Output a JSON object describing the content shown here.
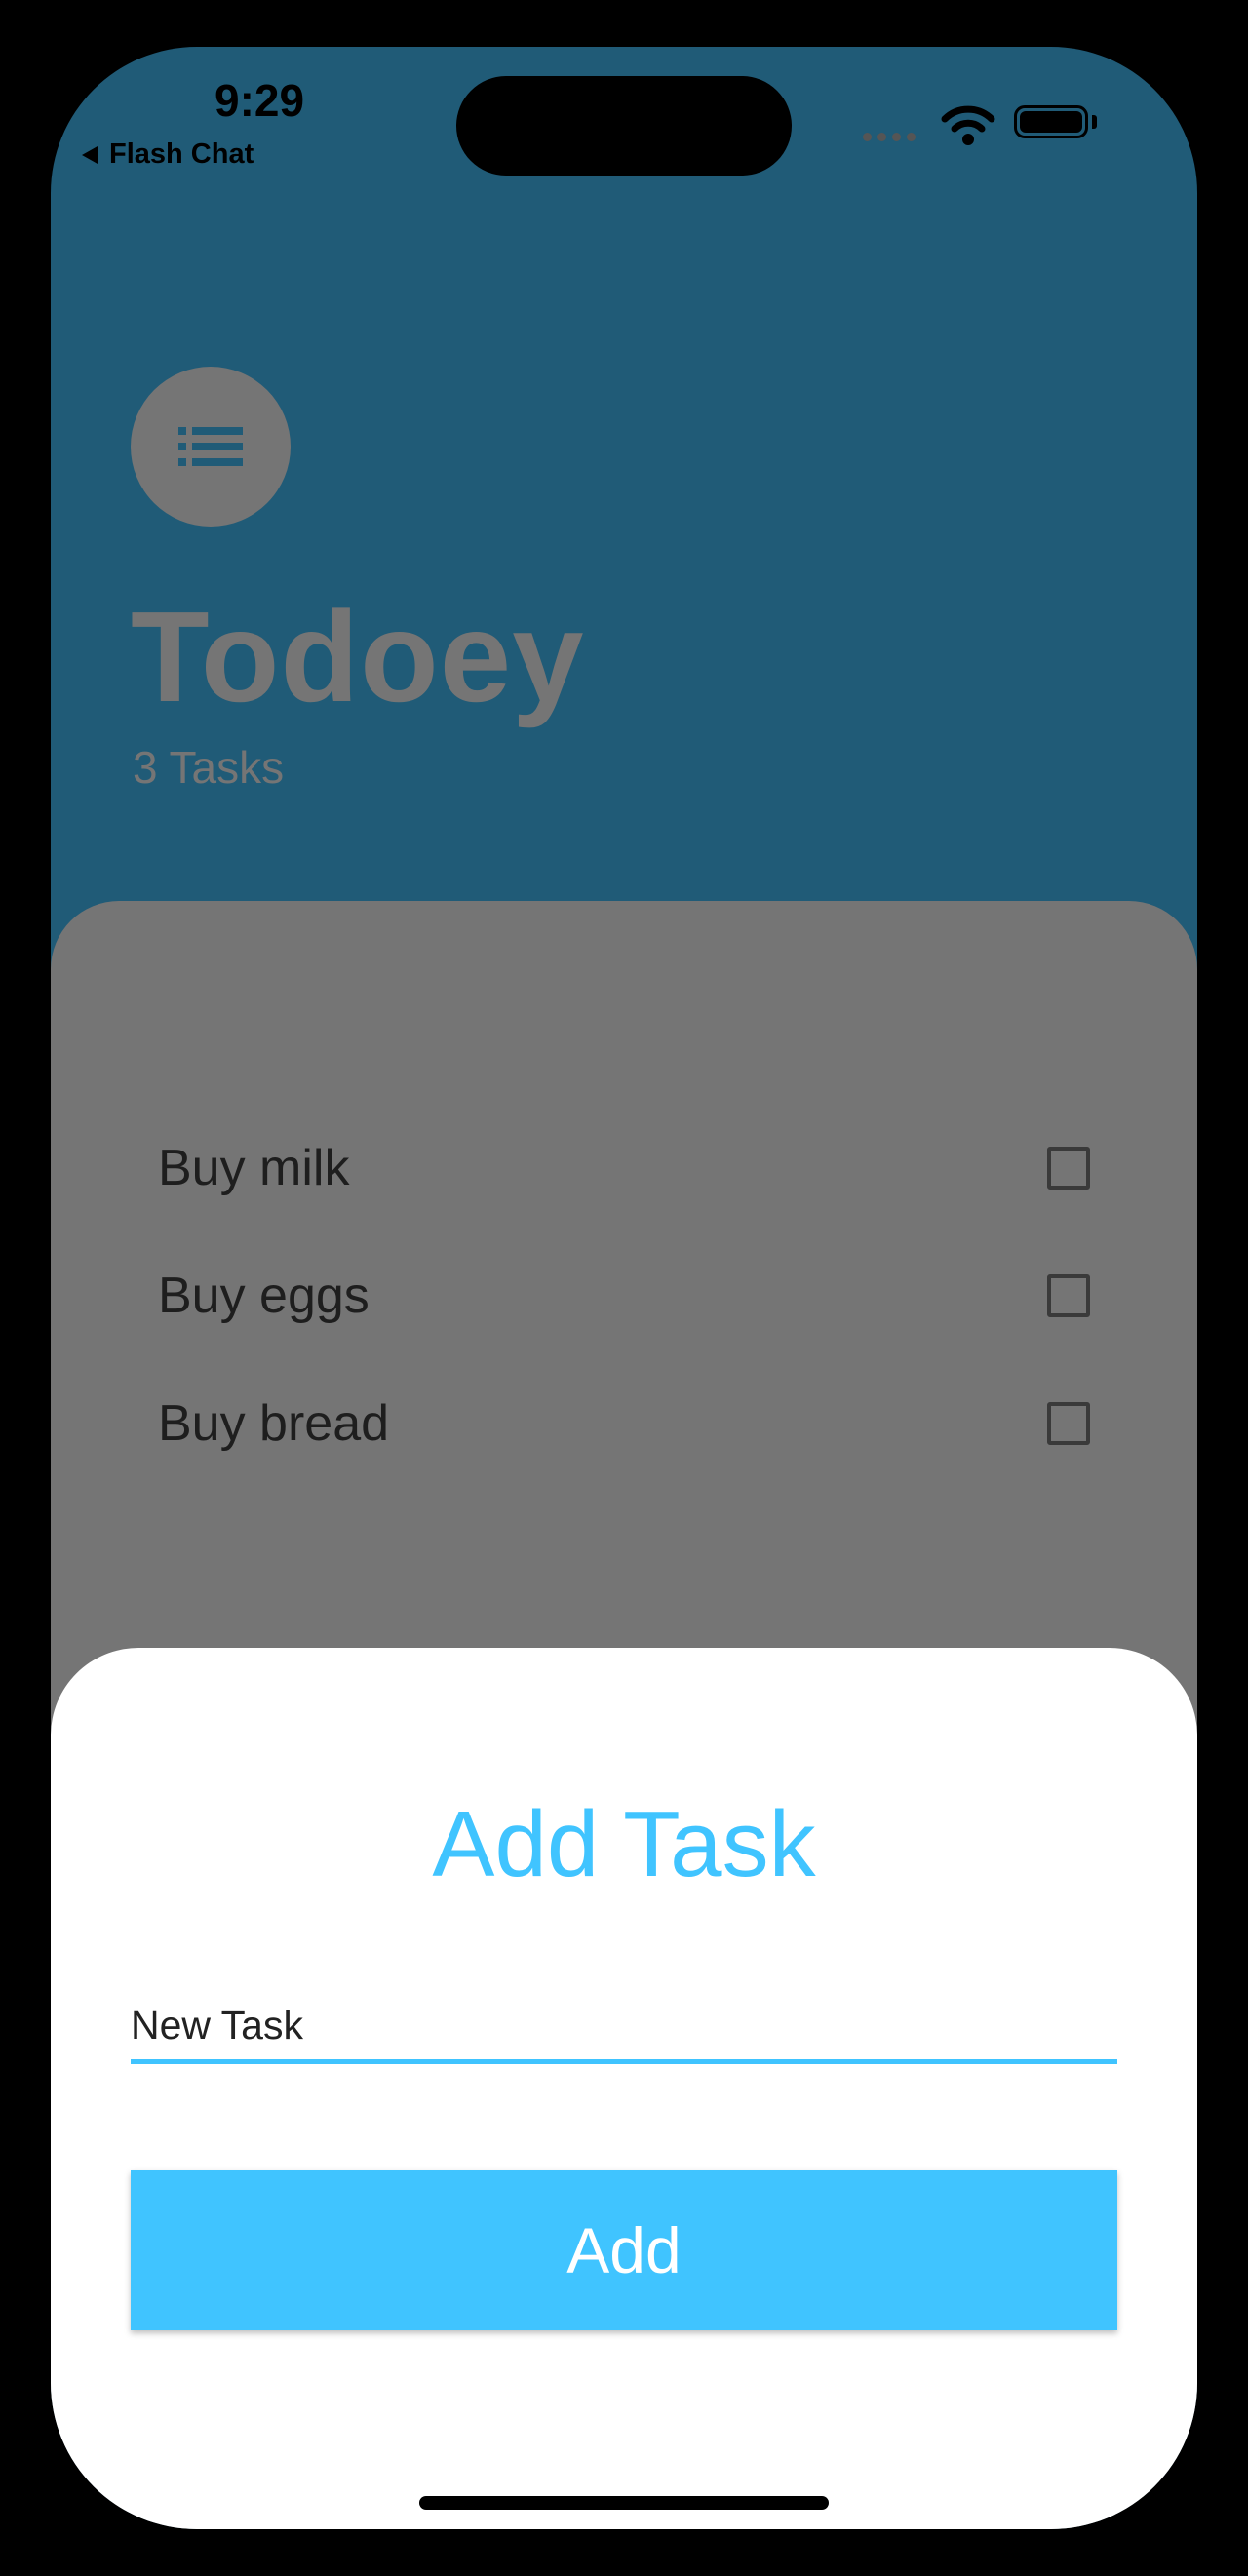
{
  "status_bar": {
    "time": "9:29",
    "back_app": "Flash Chat"
  },
  "header": {
    "icon": "list-icon",
    "title": "Todoey",
    "task_count": "3 Tasks"
  },
  "tasks": [
    {
      "label": "Buy milk",
      "checked": false
    },
    {
      "label": "Buy eggs",
      "checked": false
    },
    {
      "label": "Buy bread",
      "checked": false
    }
  ],
  "add_sheet": {
    "title": "Add Task",
    "input_value": "New Task",
    "button_label": "Add"
  },
  "colors": {
    "header_background": "#205b77",
    "accent": "#40c4ff",
    "overlay_gray": "#757575"
  }
}
